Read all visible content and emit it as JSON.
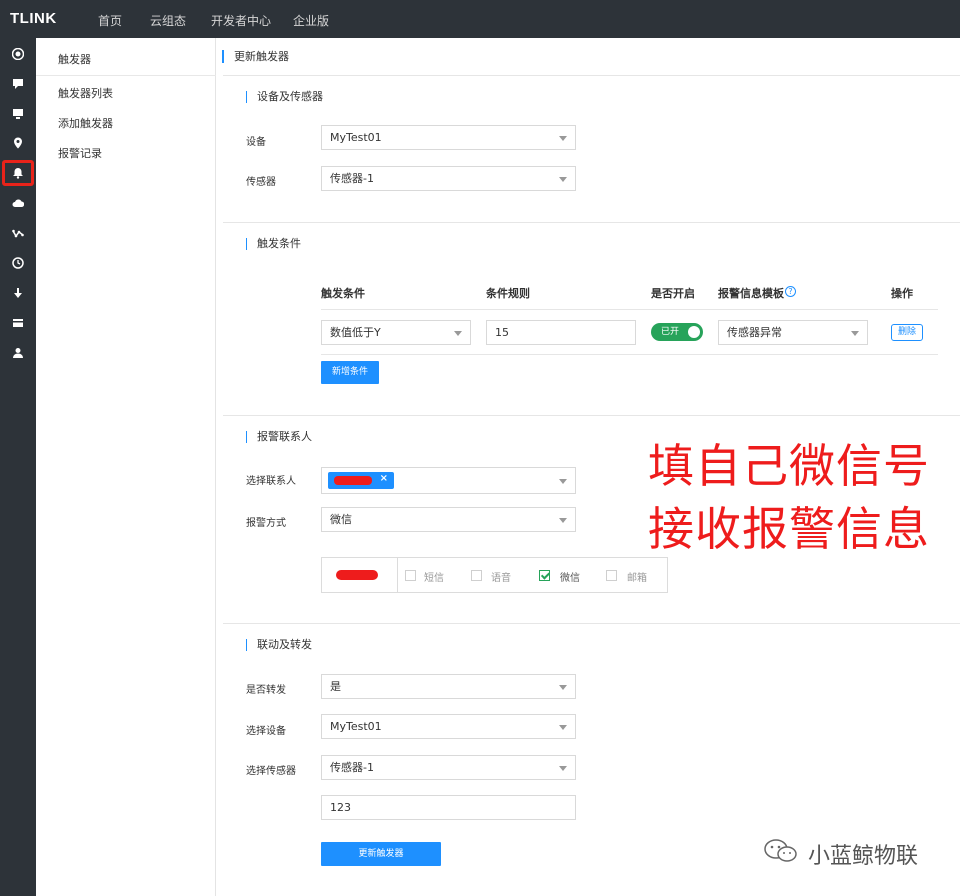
{
  "topbar": {
    "logo": "TLINK",
    "nav": [
      "首页",
      "云组态",
      "开发者中心",
      "企业版"
    ]
  },
  "rail": {
    "icons": [
      "target-icon",
      "chat-icon",
      "monitor-icon",
      "location-icon",
      "bell-icon",
      "cloud-icon",
      "network-icon",
      "clock-icon",
      "download-icon",
      "card-icon",
      "user-icon"
    ],
    "active": "bell-icon",
    "highlight_color": "#e8231a"
  },
  "sidebar": {
    "title": "触发器",
    "items": [
      "触发器列表",
      "添加触发器",
      "报警记录"
    ]
  },
  "main": {
    "title": "更新触发器",
    "device_section": {
      "title": "设备及传感器",
      "device_label": "设备",
      "device_value": "MyTest01",
      "sensor_label": "传感器",
      "sensor_value": "传感器-1"
    },
    "trigger_section": {
      "title": "触发条件",
      "headers": [
        "触发条件",
        "条件规则",
        "是否开启",
        "报警信息模板",
        "操作"
      ],
      "row": {
        "condition": "数值低于Y",
        "rule": "15",
        "enabled": "已开",
        "template": "传感器异常",
        "action": "删除"
      },
      "add_button": "新增条件"
    },
    "contact_section": {
      "title": "报警联系人",
      "contact_label": "选择联系人",
      "method_label": "报警方式",
      "method_value": "微信",
      "channels": [
        {
          "label": "短信",
          "checked": false
        },
        {
          "label": "语音",
          "checked": false
        },
        {
          "label": "微信",
          "checked": true
        },
        {
          "label": "邮箱",
          "checked": false
        }
      ]
    },
    "forward_section": {
      "title": "联动及转发",
      "forward_label": "是否转发",
      "forward_value": "是",
      "device_label": "选择设备",
      "device_value": "MyTest01",
      "sensor_label": "选择传感器",
      "sensor_value": "传感器-1",
      "extra_value": "123",
      "submit_button": "更新触发器"
    }
  },
  "annotation": {
    "line1": "填自己微信号",
    "line2": "接收报警信息",
    "color": "#ee1c1c"
  },
  "watermark": {
    "text": "小蓝鲸物联"
  },
  "colors": {
    "accent": "#1e90ff",
    "toggle_on": "#27a35a",
    "dark_bg": "#2d3339"
  }
}
